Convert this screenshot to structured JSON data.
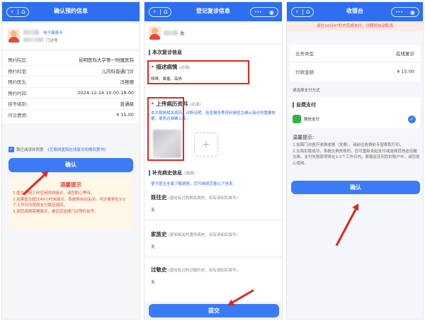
{
  "colors": {
    "primary": "#2d6ff0",
    "button": "#3b7bf6",
    "price": "#e8483a",
    "annotation": "#e8241a"
  },
  "nav": {
    "back_icon": "back-arrow-icon",
    "home_icon": "home-icon",
    "back_glyph": "‹",
    "home_glyph": "⌂"
  },
  "screen1": {
    "title": "确认预约信息",
    "card_type": "电子健康卡",
    "card_no_label": "门诊号",
    "rows": [
      {
        "label": "预约院区:",
        "value": "昆明医科大学第一附属医院"
      },
      {
        "label": "预约科室:",
        "value": "儿内科普通门诊"
      },
      {
        "label": "预约医生:",
        "value": "冯艳丽"
      },
      {
        "label": "预约时间:",
        "value": "2024-12-16 10:00-18:00"
      },
      {
        "label": "挂号级别:",
        "value": "普通级"
      },
      {
        "label": "问诊费用:",
        "value": "¥ 15.00"
      }
    ],
    "agree_prefix": "我已阅读并同意",
    "agree_link": "《互联网医院在线复诊知情同意书》",
    "confirm": "确认",
    "tips_title": "温馨提示",
    "tips": [
      "1.医生利用工作空闲时间接诊，请您耐心等待。",
      "2.如果医生超过48小时未接诊，系统将自动关闭。问诊费将在3-5个工作日内按原支付路径退回。",
      "3.如您病情需要面诊，建议您选择门诊预约挂号。"
    ]
  },
  "screen2": {
    "title": "登记复诊信息",
    "gender": "女",
    "section_title": "本次复诊信息",
    "complaint_label": "描述病情",
    "required": "(必填)",
    "complaint_value": "咳嗽、鼻塞、高热",
    "upload_label": "上传病历资料",
    "upload_note": "本次病情相关病历、诊断证明、检查报告等资料是医生确认接诊的重要依据，请务必准确上传。",
    "history_title": "补充病史信息",
    "optional": "(选填)",
    "history_note": "便于医生全面了解病情，您可继续完善以下信息",
    "past_label": "既往史",
    "past_hint": "(曾经有过的相关病史，如有请如实填写)",
    "past_value": "无",
    "family_label": "家族史",
    "family_hint": "(家族相关的遗传病史，如有请如实填写)",
    "family_value": "无",
    "allergy_label": "过敏史",
    "allergy_hint": "(曾经有过的过敏历史，如有请如实填写)",
    "allergy_value": "无",
    "submit": "提交",
    "capsule_icons": [
      "more-dots-icon",
      "close-circle-icon"
    ],
    "capsule_glyphs": [
      "•••",
      "◉"
    ]
  },
  "screen3": {
    "title": "收银台",
    "countdown": "请在10分47秒内完成支付，过期将自动取消",
    "business_label": "业务类型",
    "business_value": "在线复诊",
    "amount_label": "付款金额",
    "amount_value": "¥ 15.00",
    "choose_label": "请选择支付方式",
    "selfpay_title": "自费支付",
    "wechat": "微信支付",
    "tips_title": "温馨提示:",
    "tips": [
      "1.如需门诊医疗收费收据（发票），请前往收费处专窗索取打印。",
      "2.交易扣款成功，系统交费失败时，您可重新发起支付或选择其他途径缴交费。支付失败款项将在1-5个工作日内，原路返还到您的账户中，请您放心使用。"
    ],
    "confirm": "确认"
  }
}
